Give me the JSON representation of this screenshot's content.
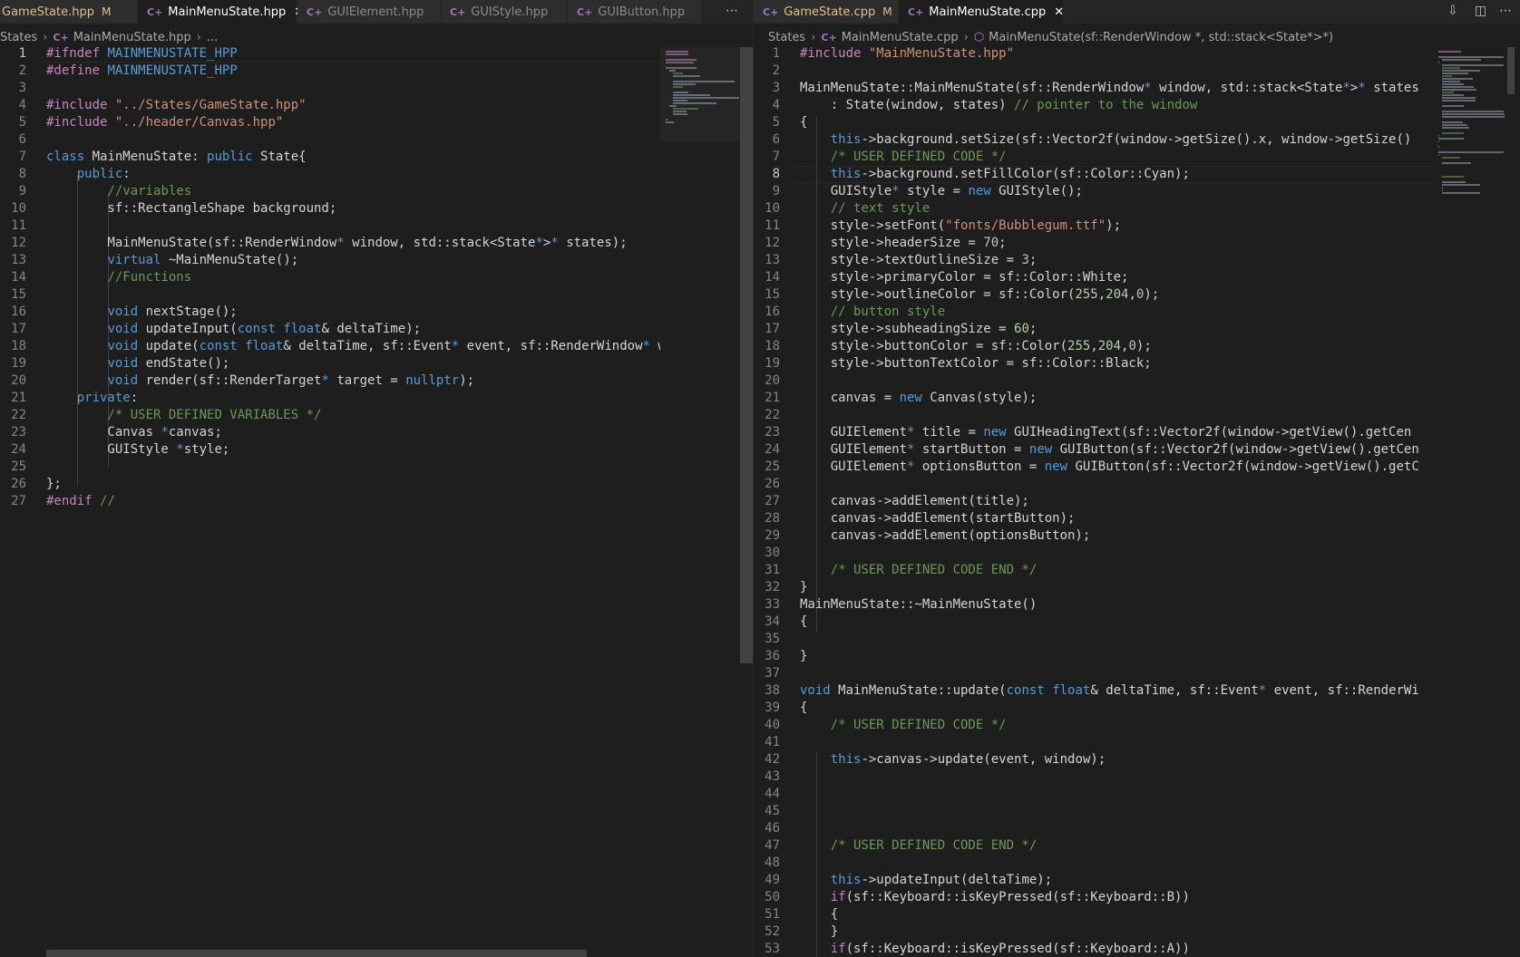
{
  "left": {
    "tabs": [
      {
        "label": "GameState.hpp",
        "modified": "M",
        "active": false
      },
      {
        "label": "MainMenuState.hpp",
        "active": true
      },
      {
        "label": "GUIElement.hpp",
        "active": false
      },
      {
        "label": "GUIStyle.hpp",
        "active": false
      },
      {
        "label": "GUIButton.hpp",
        "active": false
      }
    ],
    "more_icon": "ellipsis-icon",
    "breadcrumb": {
      "folder": "States",
      "file": "MainMenuState.hpp",
      "tail": "..."
    },
    "current_line": 1,
    "lines": [
      "#ifndef MAINMENUSTATE_HPP",
      "#define MAINMENUSTATE_HPP",
      "",
      "#include \"../States/GameState.hpp\"",
      "#include \"../header/Canvas.hpp\"",
      "",
      "class MainMenuState: public State{",
      "    public:",
      "        //variables",
      "        sf::RectangleShape background;",
      "",
      "        MainMenuState(sf::RenderWindow* window, std::stack<State*>* states);",
      "        virtual ~MainMenuState();",
      "        //Functions",
      "",
      "        void nextStage();",
      "        void updateInput(const float& deltaTime);",
      "        void update(const float& deltaTime, sf::Event* event, sf::RenderWindow* w",
      "        void endState();",
      "        void render(sf::RenderTarget* target = nullptr);",
      "    private:",
      "        /* USER DEFINED VARIABLES */",
      "        Canvas *canvas;",
      "        GUIStyle *style;",
      "",
      "};",
      "#endif //"
    ]
  },
  "right": {
    "tabs": [
      {
        "label": "GameState.cpp",
        "modified": "M",
        "active": false
      },
      {
        "label": "MainMenuState.cpp",
        "active": true
      }
    ],
    "toolbar_icons": [
      "open-changes-icon",
      "split-editor-icon",
      "ellipsis-icon"
    ],
    "breadcrumb": {
      "folder": "States",
      "file": "MainMenuState.cpp",
      "symbol": "MainMenuState(sf::RenderWindow *, std::stack<State*>*)"
    },
    "current_line": 8,
    "lines": [
      "#include \"MainMenuState.hpp\"",
      "",
      "MainMenuState::MainMenuState(sf::RenderWindow* window, std::stack<State*>* states",
      "    : State(window, states) // pointer to the window",
      "{",
      "    this->background.setSize(sf::Vector2f(window->getSize().x, window->getSize()",
      "    /* USER DEFINED CODE */",
      "    this->background.setFillColor(sf::Color::Cyan);",
      "    GUIStyle* style = new GUIStyle();",
      "    // text style",
      "    style->setFont(\"fonts/Bubblegum.ttf\");",
      "    style->headerSize = 70;",
      "    style->textOutlineSize = 3;",
      "    style->primaryColor = sf::Color::White;",
      "    style->outlineColor = sf::Color(255,204,0);",
      "    // button style",
      "    style->subheadingSize = 60;",
      "    style->buttonColor = sf::Color(255,204,0);",
      "    style->buttonTextColor = sf::Color::Black;",
      "",
      "    canvas = new Canvas(style);",
      "",
      "    GUIElement* title = new GUIHeadingText(sf::Vector2f(window->getView().getCen",
      "    GUIElement* startButton = new GUIButton(sf::Vector2f(window->getView().getCen",
      "    GUIElement* optionsButton = new GUIButton(sf::Vector2f(window->getView().getC",
      "",
      "    canvas->addElement(title);",
      "    canvas->addElement(startButton);",
      "    canvas->addElement(optionsButton);",
      "",
      "    /* USER DEFINED CODE END */",
      "}",
      "MainMenuState::~MainMenuState()",
      "{",
      "",
      "}",
      "",
      "void MainMenuState::update(const float& deltaTime, sf::Event* event, sf::RenderWi",
      "{",
      "    /* USER DEFINED CODE */",
      "",
      "    this->canvas->update(event, window);",
      "",
      "",
      "",
      "",
      "    /* USER DEFINED CODE END */",
      "",
      "    this->updateInput(deltaTime);",
      "    if(sf::Keyboard::isKeyPressed(sf::Keyboard::B))",
      "    {",
      "    }",
      "    if(sf::Keyboard::isKeyPressed(sf::Keyboard::A))"
    ]
  },
  "colors": {
    "keyword": "#569cd6",
    "control": "#c586c0",
    "string": "#ce9178",
    "comment": "#6a9955",
    "number": "#b5cea8",
    "modified": "#e2c08d",
    "background": "#1e1e1e"
  }
}
